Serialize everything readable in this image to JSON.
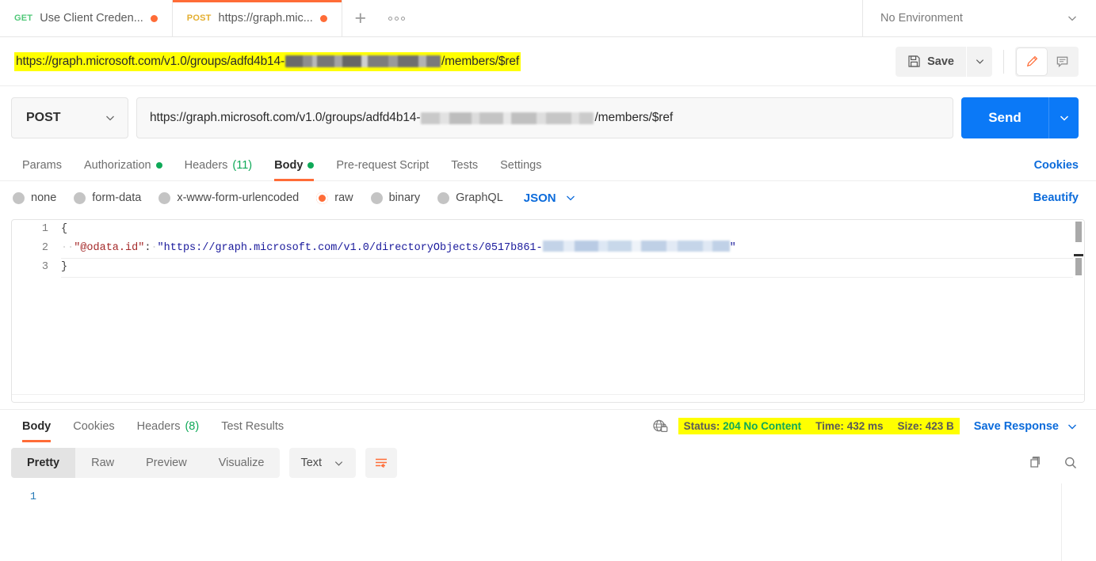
{
  "tabbar": {
    "tabs": [
      {
        "method": "GET",
        "name": "Use Client Creden...",
        "unsaved": true,
        "active": false
      },
      {
        "method": "POST",
        "name": "https://graph.mic...",
        "unsaved": true,
        "active": true
      }
    ],
    "new_tab_icon": "plus-icon",
    "more_icon": "more-options-icon",
    "environment": "No Environment"
  },
  "title": {
    "url_prefix": "https://graph.microsoft.com/v1.0/groups/adfd4b14-",
    "url_suffix": "/members/$ref",
    "save_label": "Save",
    "save_icon": "floppy-disk-icon",
    "save_caret_icon": "chevron-down-icon",
    "edit_icon": "pencil-icon",
    "comment_icon": "comment-icon"
  },
  "request": {
    "method": "POST",
    "method_caret_icon": "chevron-down-icon",
    "url_prefix": "https://graph.microsoft.com/v1.0/groups/adfd4b14-",
    "url_suffix": "/members/$ref",
    "send_label": "Send",
    "send_caret_icon": "chevron-down-icon",
    "tabs": [
      {
        "label": "Params",
        "badge": "",
        "dot": false,
        "active": false
      },
      {
        "label": "Authorization",
        "badge": "",
        "dot": true,
        "active": false
      },
      {
        "label": "Headers",
        "badge": "(11)",
        "dot": false,
        "active": false
      },
      {
        "label": "Body",
        "badge": "",
        "dot": true,
        "active": true
      },
      {
        "label": "Pre-request Script",
        "badge": "",
        "dot": false,
        "active": false
      },
      {
        "label": "Tests",
        "badge": "",
        "dot": false,
        "active": false
      },
      {
        "label": "Settings",
        "badge": "",
        "dot": false,
        "active": false
      }
    ],
    "cookies_link": "Cookies",
    "beautify_link": "Beautify",
    "body_types": [
      {
        "label": "none",
        "selected": false
      },
      {
        "label": "form-data",
        "selected": false
      },
      {
        "label": "x-www-form-urlencoded",
        "selected": false
      },
      {
        "label": "raw",
        "selected": true
      },
      {
        "label": "binary",
        "selected": false
      },
      {
        "label": "GraphQL",
        "selected": false
      }
    ],
    "raw_format": "JSON",
    "raw_format_caret_icon": "chevron-down-icon",
    "body_code": {
      "line1_number": "1",
      "line1_text": "{",
      "line2_number": "2",
      "line2_indent": "··",
      "line2_key": "\"@odata.id\"",
      "line2_colon": ":",
      "line2_space": "·",
      "line2_value_prefix": "\"https://graph.microsoft.com/v1.0/directoryObjects/0517b861-",
      "line2_value_suffix": "\"",
      "line3_number": "3",
      "line3_text": "}"
    }
  },
  "response": {
    "tabs": [
      {
        "label": "Body",
        "badge": "",
        "active": true
      },
      {
        "label": "Cookies",
        "badge": "",
        "active": false
      },
      {
        "label": "Headers",
        "badge": "(8)",
        "active": false
      },
      {
        "label": "Test Results",
        "badge": "",
        "active": false
      }
    ],
    "secure_icon": "globe-lock-icon",
    "status_label": "Status:",
    "status_value": "204 No Content",
    "time_label": "Time:",
    "time_value": "432 ms",
    "size_label": "Size:",
    "size_value": "423 B",
    "save_response_label": "Save Response",
    "save_response_caret_icon": "chevron-down-icon",
    "view_modes": [
      {
        "label": "Pretty",
        "active": true
      },
      {
        "label": "Raw",
        "active": false
      },
      {
        "label": "Preview",
        "active": false
      },
      {
        "label": "Visualize",
        "active": false
      }
    ],
    "format": "Text",
    "format_caret_icon": "chevron-down-icon",
    "wrap_icon": "word-wrap-icon",
    "copy_icon": "copy-icon",
    "search_icon": "search-icon",
    "body_line_number": "1",
    "body_text": ""
  },
  "colors": {
    "accent_orange": "#ff6c37",
    "send_blue": "#0b79f7",
    "link_blue": "#0b6bdb",
    "green": "#0fa958",
    "highlight_yellow": "#ffff00"
  }
}
